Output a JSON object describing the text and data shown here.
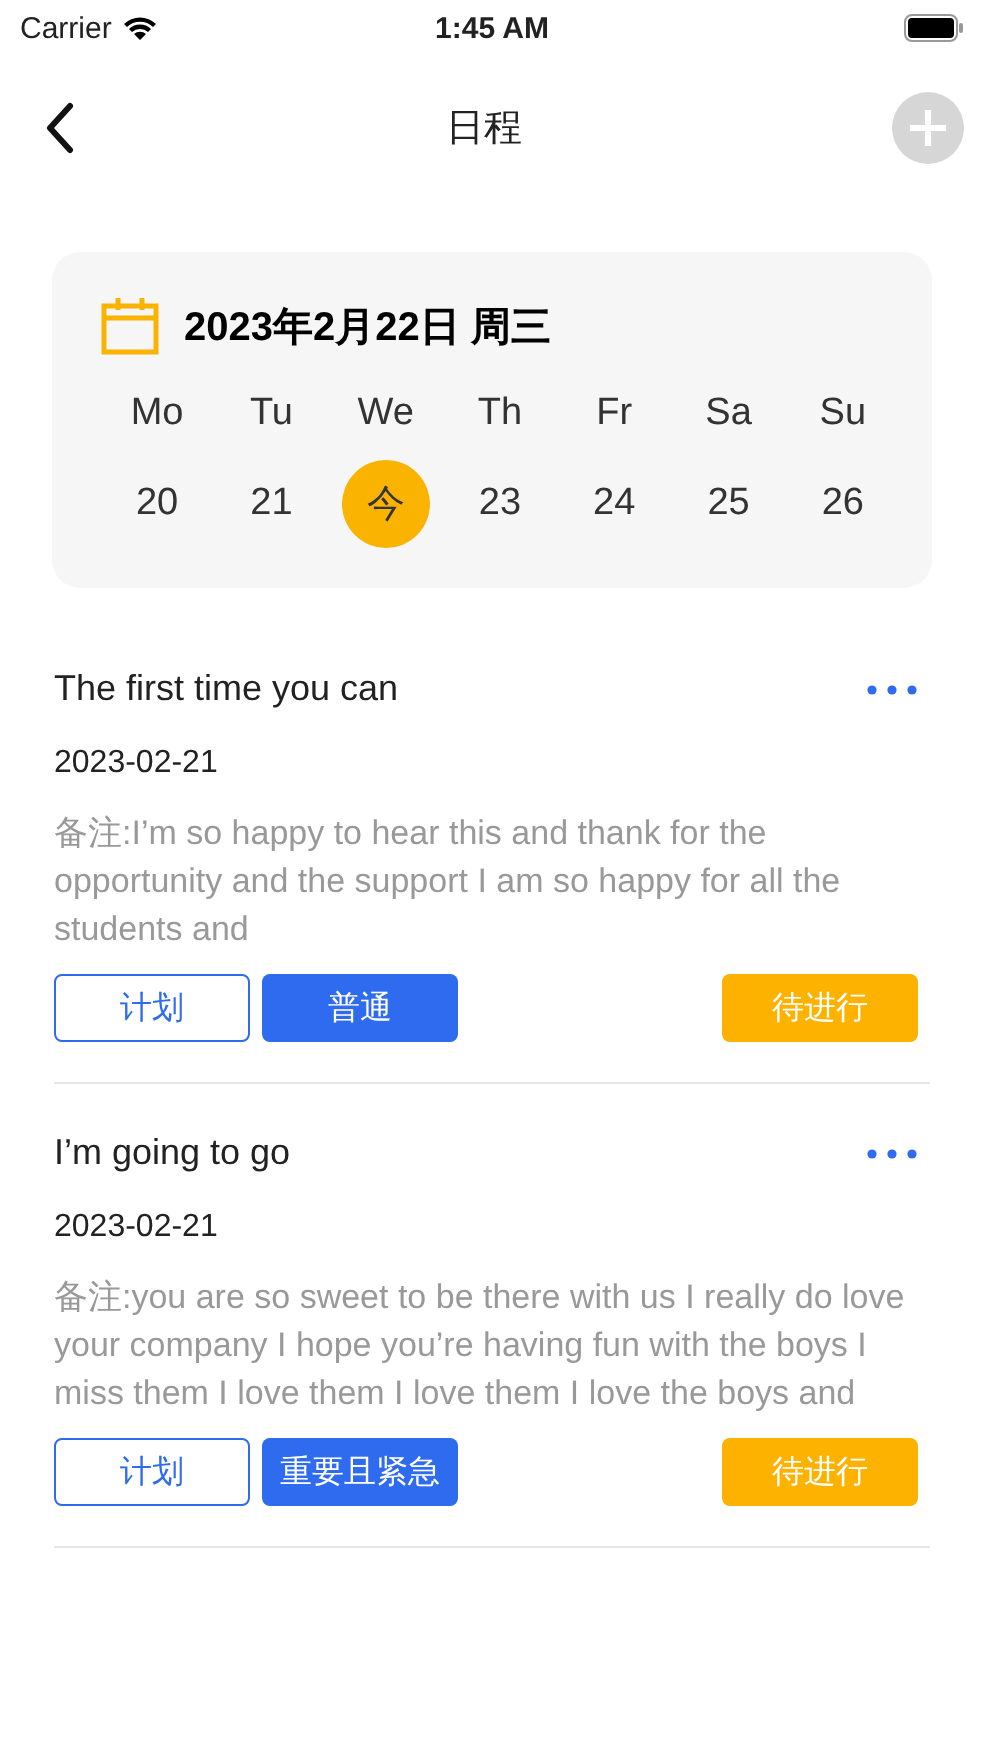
{
  "status_bar": {
    "carrier": "Carrier",
    "time": "1:45 AM"
  },
  "nav": {
    "title": "日程"
  },
  "calendar": {
    "date": "2023年2月22日 周三",
    "weekdays": [
      "Mo",
      "Tu",
      "We",
      "Th",
      "Fr",
      "Sa",
      "Su"
    ],
    "days": [
      {
        "label": "20",
        "selected": false
      },
      {
        "label": "21",
        "selected": false
      },
      {
        "label": "今",
        "selected": true
      },
      {
        "label": "23",
        "selected": false
      },
      {
        "label": "24",
        "selected": false
      },
      {
        "label": "25",
        "selected": false
      },
      {
        "label": "26",
        "selected": false
      }
    ]
  },
  "events": [
    {
      "title": "The first time you can",
      "date": "2023-02-21",
      "note": "备注:I’m so happy to hear this and thank for the opportunity and the support I am so happy for all the students and",
      "tags": [
        {
          "label": "计划",
          "kind": "outline"
        },
        {
          "label": "普通",
          "kind": "filled"
        }
      ],
      "status": "待进行"
    },
    {
      "title": "I’m going to go",
      "date": "2023-02-21",
      "note": "备注:you are so sweet to be there with us I really do love your company I hope you’re having fun with the boys I miss them I love them I love them I love the boys and",
      "tags": [
        {
          "label": "计划",
          "kind": "outline"
        },
        {
          "label": "重要且紧急",
          "kind": "filled"
        }
      ],
      "status": "待进行"
    }
  ]
}
